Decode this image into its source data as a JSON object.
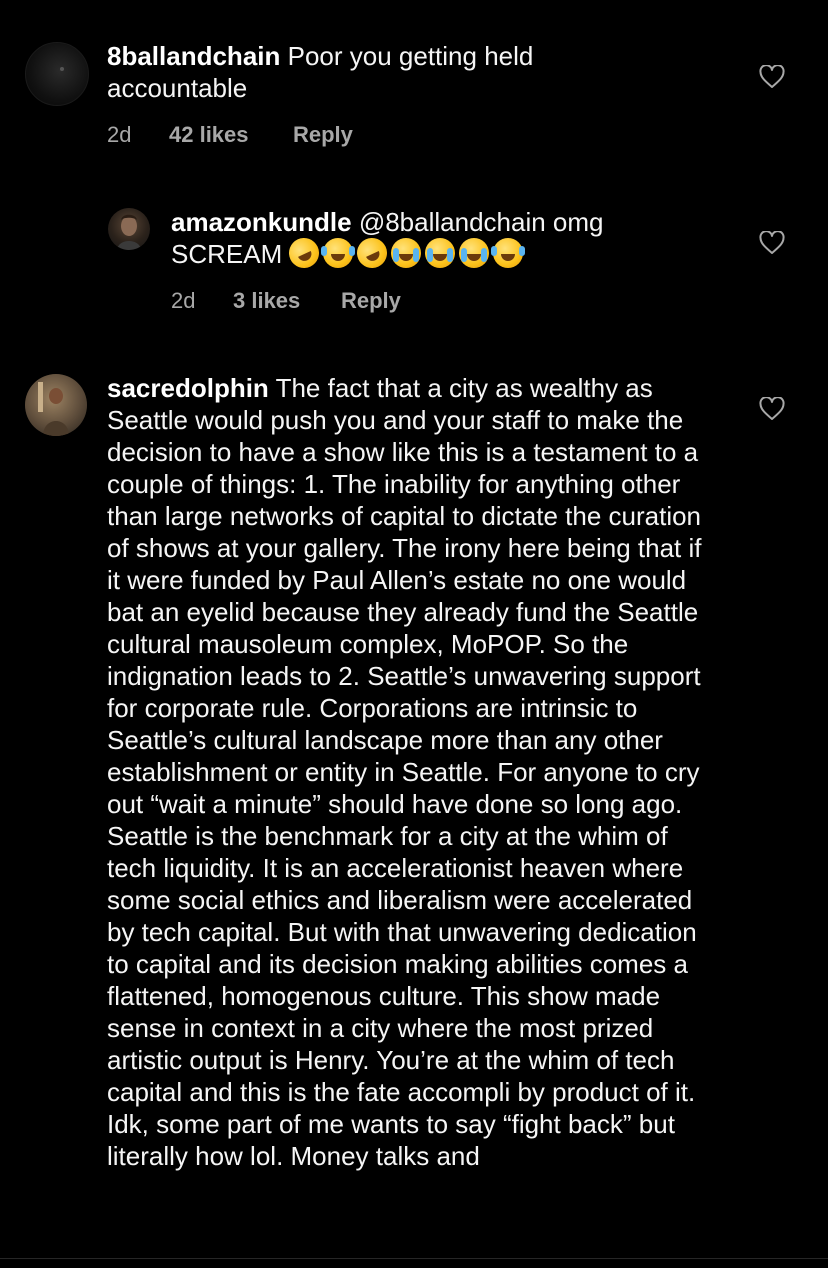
{
  "comments": [
    {
      "username": "8ballandchain",
      "text": " Poor you getting held accountable",
      "time": "2d",
      "likes": "42 likes",
      "reply": "Reply"
    },
    {
      "username": "amazonkundle",
      "text": " @8ballandchain omg SCREAM ",
      "emojis": [
        "rolling-on-floor-laughing",
        "face-with-tears-of-joy",
        "rolling-on-floor-laughing",
        "loudly-crying-face",
        "loudly-crying-face",
        "loudly-crying-face",
        "face-with-tears-of-joy"
      ],
      "time": "2d",
      "likes": "3 likes",
      "reply": "Reply"
    },
    {
      "username": "sacredolphin",
      "text": " The fact that a city as wealthy as Seattle would push you and your staff to make the decision to have a show like this is a testament to a couple of things: 1. The inability for anything other than large networks of capital to dictate the curation of shows at your gallery. The irony here being that if it were funded by Paul Allen’s estate no one would bat an eyelid because they already fund the Seattle cultural mausoleum complex, MoPOP. So the indignation leads to 2. Seattle’s unwavering support for corporate rule. Corporations are intrinsic to Seattle’s cultural landscape more than any other establishment or entity in Seattle. For anyone to cry out “wait a minute” should have done so long ago. Seattle is the benchmark for a city at the whim of tech liquidity. It is an accelerationist heaven where some social ethics and liberalism were accelerated by tech capital. But with that unwavering dedication to capital and its decision making abilities comes a flattened, homogenous culture. This show made sense in context in a city where the most prized artistic output is Henry. You’re at the whim of tech capital and this is the fate accompli by product of it. Idk, some part of me wants to say “fight back” but literally how lol. Money talks and"
    }
  ],
  "colors": {
    "background": "#000000",
    "text": "#f5f5f5",
    "meta": "#a8a8a8"
  }
}
